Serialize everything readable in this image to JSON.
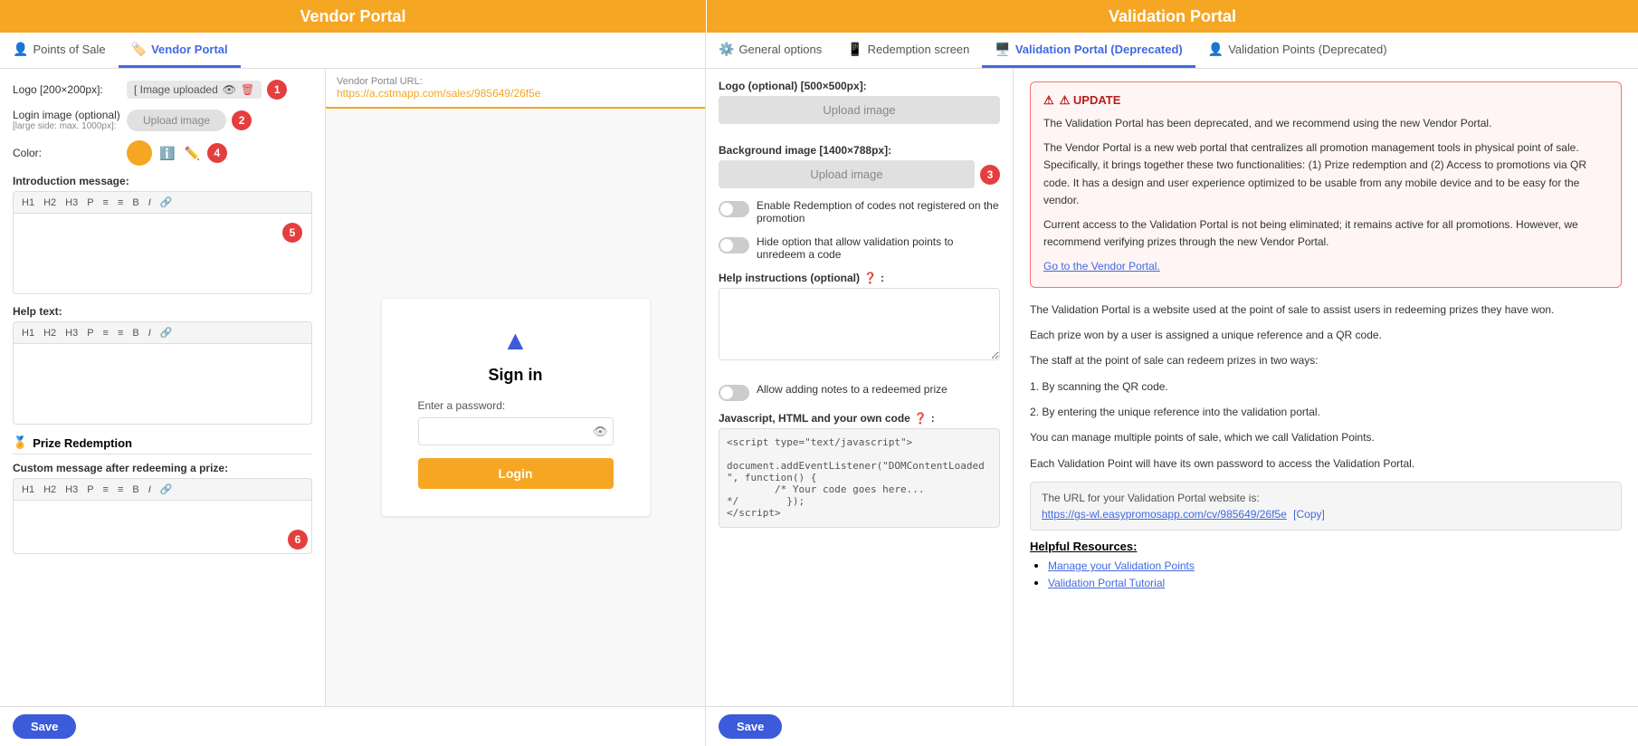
{
  "left_header": "Vendor Portal",
  "right_header": "Validation Portal",
  "tabs_left": [
    {
      "id": "pos",
      "label": "Points of Sale",
      "icon": "👤",
      "active": false
    },
    {
      "id": "vendor",
      "label": "Vendor Portal",
      "icon": "🏷️",
      "active": true
    }
  ],
  "tabs_right": [
    {
      "id": "general",
      "label": "General options",
      "icon": "⚙️",
      "active": false
    },
    {
      "id": "redemption",
      "label": "Redemption screen",
      "icon": "📱",
      "active": false
    },
    {
      "id": "validation",
      "label": "Validation Portal (Deprecated)",
      "icon": "🖥️",
      "active": true
    },
    {
      "id": "valpoints",
      "label": "Validation Points (Deprecated)",
      "icon": "👤",
      "active": false
    }
  ],
  "left_form": {
    "logo_label": "Logo [200×200px]:",
    "logo_uploaded": "[ Image uploaded",
    "login_image_label": "Login image (optional)",
    "login_image_sublabel": "[large side: max. 1000px]:",
    "upload_btn": "Upload image",
    "color_label": "Color:",
    "intro_message_label": "Introduction message:",
    "help_text_label": "Help text:",
    "toolbar_items": [
      "H1",
      "H2",
      "H3",
      "P",
      "≡",
      "≡",
      "B",
      "I",
      "🔗"
    ],
    "prize_redemption_title": "Prize Redemption",
    "custom_message_label": "Custom message after redeeming a prize:",
    "save_btn": "Save"
  },
  "preview": {
    "url_label": "Vendor Portal URL:",
    "url_value": "https://a.cstmapp.com/sales/985649/26f5e",
    "signin_title": "Sign in",
    "password_label": "Enter a password:",
    "login_btn": "Login"
  },
  "right_form": {
    "logo_label": "Logo (optional) [500×500px]:",
    "bg_image_label": "Background image [1400×788px]:",
    "upload_btn": "Upload image",
    "enable_toggle_label": "Enable Redemption of codes not registered on the promotion",
    "hide_toggle_label": "Hide option that allow validation points to unredeem a code",
    "help_instructions_label": "Help instructions (optional)",
    "allow_notes_label": "Allow adding notes to a redeemed prize",
    "js_html_label": "Javascript, HTML and your own code",
    "code_placeholder": "<script type=\"text/javascript\">\n\ndocument.addEventListener(\"DOMContentLoaded\n\", function() {\n        /* Your code goes here...\n*/        });\n</script>",
    "save_btn": "Save"
  },
  "right_info": {
    "update_title": "⚠ UPDATE",
    "update_body": "The Validation Portal has been deprecated, and we recommend using the new Vendor Portal.\n\nThe Vendor Portal is a new web portal that centralizes all promotion management tools in physical point of sale. Specifically, it brings together these two functionalities: (1) Prize redemption and (2) Access to promotions via QR code. It has a design and user experience optimized to be usable from any mobile device and to be easy for the vendor.\n\nCurrent access to the Validation Portal is not being eliminated; it remains active for all promotions. However, we recommend verifying prizes through the new Vendor Portal.",
    "update_link": "Go to the Vendor Portal.",
    "info1": "The Validation Portal is a website used at the point of sale to assist users in redeeming prizes they have won.",
    "info2": "Each prize won by a user is assigned a unique reference and a QR code.",
    "info3": "The staff at the point of sale can redeem prizes in two ways:",
    "info3a": "1. By scanning the QR code.",
    "info3b": "2. By entering the unique reference into the validation portal.",
    "info4": "You can manage multiple points of sale, which we call Validation Points.",
    "info5": "Each Validation Point will have its own password to access the Validation Portal.",
    "url_box_label": "The URL for your Validation Portal website is:",
    "url_box_link": "https://gs-wl.easypromosapp.com/cv/985649/26f5e",
    "copy_label": "[Copy]",
    "helpful_resources": "Helpful Resources:",
    "resource1": "Manage your Validation Points",
    "resource2": "Validation Portal Tutorial"
  },
  "badges": {
    "b1": "1",
    "b2": "2",
    "b3": "3",
    "b4": "4",
    "b5": "5",
    "b6": "6"
  }
}
